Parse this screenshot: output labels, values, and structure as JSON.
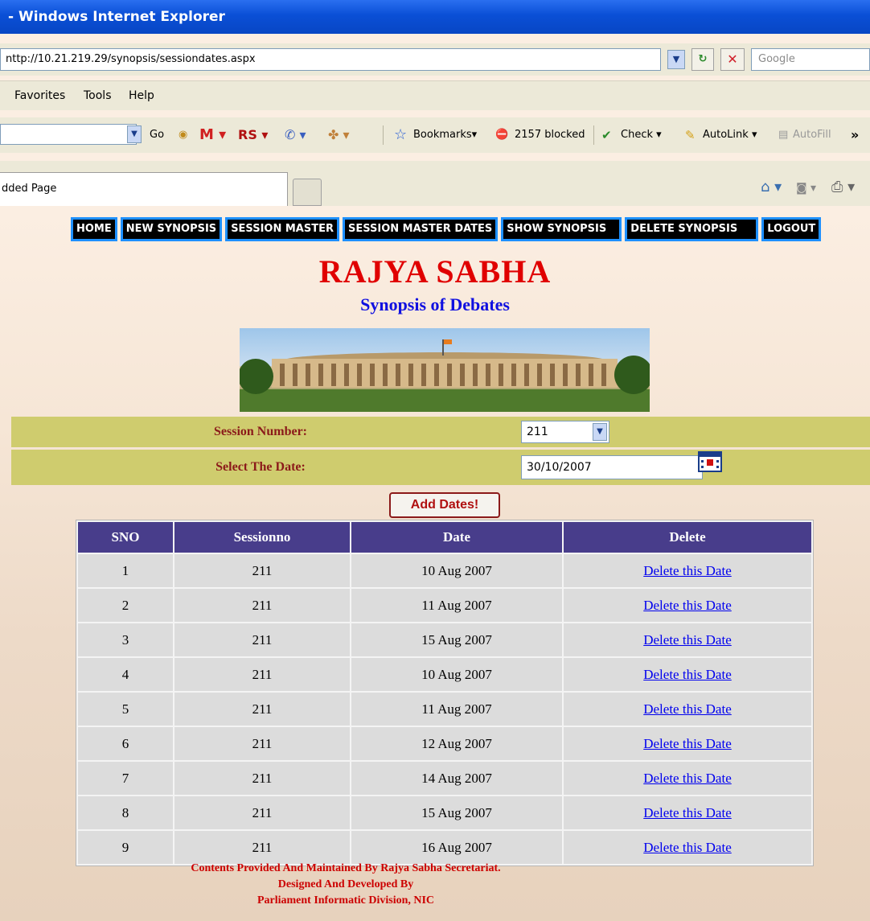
{
  "window": {
    "title": "- Windows Internet Explorer"
  },
  "address": {
    "url": "nttp://10.21.219.29/synopsis/sessiondates.aspx",
    "search_placeholder": "Google"
  },
  "menu": {
    "items": [
      "Favorites",
      "Tools",
      "Help"
    ]
  },
  "toolbar": {
    "go": "Go",
    "rs": "RS",
    "bookmarks": "Bookmarks",
    "blocked": "2157 blocked",
    "check": "Check",
    "autolink": "AutoLink",
    "autofill": "AutoFill",
    "more": "»"
  },
  "tab": {
    "title": "dded Page"
  },
  "nav": {
    "items": [
      "HOME",
      "NEW SYNOPSIS",
      "SESSION MASTER",
      "SESSION MASTER DATES",
      "SHOW SYNOPSIS",
      "DELETE SYNOPSIS",
      "LOGOUT"
    ]
  },
  "header": {
    "title": "RAJYA SABHA",
    "subtitle": "Synopsis of Debates"
  },
  "form": {
    "session_label": "Session Number:",
    "session_value": "211",
    "date_label": "Select The Date:",
    "date_value": "30/10/2007",
    "add_button": "Add Dates!"
  },
  "table": {
    "headers": [
      "SNO",
      "Sessionno",
      "Date",
      "Delete"
    ],
    "rows": [
      {
        "sno": "1",
        "session": "211",
        "date": "10 Aug 2007",
        "action": "Delete this Date"
      },
      {
        "sno": "2",
        "session": "211",
        "date": "11 Aug 2007",
        "action": "Delete this Date"
      },
      {
        "sno": "3",
        "session": "211",
        "date": "15 Aug 2007",
        "action": "Delete this Date"
      },
      {
        "sno": "4",
        "session": "211",
        "date": "10 Aug 2007",
        "action": "Delete this Date"
      },
      {
        "sno": "5",
        "session": "211",
        "date": "11 Aug 2007",
        "action": "Delete this Date"
      },
      {
        "sno": "6",
        "session": "211",
        "date": "12 Aug 2007",
        "action": "Delete this Date"
      },
      {
        "sno": "7",
        "session": "211",
        "date": "14 Aug 2007",
        "action": "Delete this Date"
      },
      {
        "sno": "8",
        "session": "211",
        "date": "15 Aug 2007",
        "action": "Delete this Date"
      },
      {
        "sno": "9",
        "session": "211",
        "date": "16 Aug 2007",
        "action": "Delete this Date"
      }
    ]
  },
  "footer": {
    "line1": "Contents Provided And Maintained By Rajya Sabha Secretariat.",
    "line2": "Designed And Developed By",
    "line3": "Parliament Informatic Division, NIC"
  },
  "colors": {
    "nav_border": "#1e90ff",
    "title": "#e00000",
    "subtitle": "#1010e0",
    "form_row": "#cfcc6e",
    "table_header": "#483d8b"
  }
}
